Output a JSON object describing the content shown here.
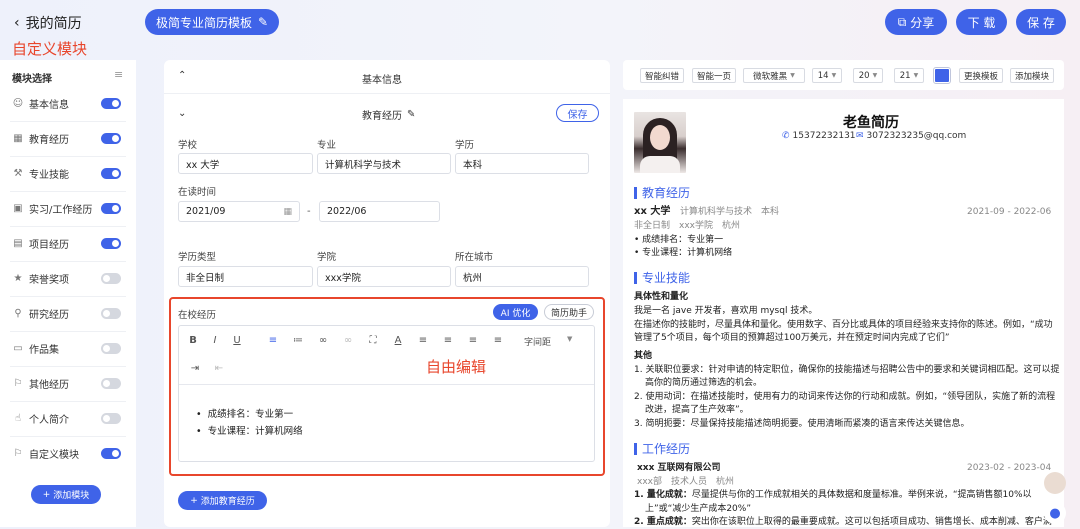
{
  "header": {
    "back_label": "我的简历",
    "custom_module_note": "自定义模块",
    "template_btn": "极简专业简历模板",
    "share": "分享",
    "download": "下 载",
    "save": "保 存"
  },
  "sidebar": {
    "title": "模块选择",
    "items": [
      {
        "label": "基本信息",
        "icon": "user-icon",
        "on": true
      },
      {
        "label": "教育经历",
        "icon": "calendar-icon",
        "on": true
      },
      {
        "label": "专业技能",
        "icon": "wrench-icon",
        "on": true
      },
      {
        "label": "实习/工作经历",
        "icon": "briefcase-icon",
        "on": true
      },
      {
        "label": "项目经历",
        "icon": "document-icon",
        "on": true
      },
      {
        "label": "荣誉奖项",
        "icon": "trophy-icon",
        "on": false
      },
      {
        "label": "研究经历",
        "icon": "search-icon",
        "on": false
      },
      {
        "label": "作品集",
        "icon": "monitor-icon",
        "on": false
      },
      {
        "label": "其他经历",
        "icon": "tag-icon",
        "on": false
      },
      {
        "label": "个人简介",
        "icon": "thumbs-up-icon",
        "on": false
      },
      {
        "label": "自定义模块",
        "icon": "tag-icon",
        "on": true
      }
    ],
    "add_module": "添加模块"
  },
  "editor": {
    "basic_info": "基本信息",
    "education": "教育经历",
    "save": "保存",
    "labels": {
      "school": "学校",
      "major": "专业",
      "degree": "学历",
      "period": "在读时间",
      "edu_type": "学历类型",
      "college": "学院",
      "city": "所在城市",
      "campus": "在校经历"
    },
    "values": {
      "school": "xx 大学",
      "major": "计算机科学与技术",
      "degree": "本科",
      "start": "2021/09",
      "end": "2022/06",
      "edu_type": "非全日制",
      "college": "xxx学院",
      "city": "杭州"
    },
    "ai_optimize": "AI 优化",
    "resume_helper": "简历助手",
    "line_spacing": "字间距",
    "free_edit_note": "自由编辑",
    "bullets": [
      "成绩排名：专业第一",
      "专业课程：计算机网络"
    ],
    "add_education": "添加教育经历"
  },
  "preview_toolbar": {
    "smart_fix": "智能纠错",
    "one_page": "智能一页",
    "font": "微软雅黑",
    "size1": "14",
    "size2": "20",
    "size3": "21",
    "accent": "#3f63e8",
    "change_template": "更换模板",
    "add_module": "添加模块"
  },
  "resume": {
    "name": "老鱼简历",
    "phone": "15372232131",
    "email": "3072323235@qq.com",
    "edu_title": "教育经历",
    "school": "xx 大学",
    "major": "计算机科学与技术",
    "degree": "本科",
    "period": "2021-09 - 2022-06",
    "edu_meta": "非全日制　xxx学院　杭州",
    "edu_bullets": [
      "成绩排名：专业第一",
      "专业课程：计算机网络"
    ],
    "skills_title": "专业技能",
    "skill_h1": "具体性和量化",
    "skill_p1": "我是一名 jave 开发者，喜欢用 mysql 技术。",
    "skill_p2a": "在描述你的技能时，尽量具体和量化。使用数字、百分比或具体的项目经验来支持你的陈述。例如，“成功",
    "skill_p2b": "管理了5个项目，每个项目的预算超过100万美元，并在预定时间内完成了它们”",
    "skill_h2": "其他",
    "skill_o1a": "1. 关联职位要求：针对申请的特定职位，确保你的技能描述与招聘公告中的要求和关键词相匹配。这可以提",
    "skill_o1b": "高你的简历通过筛选的机会。",
    "skill_o2a": "2. 使用动词：在描述技能时，使用有力的动词来传达你的行动和成就。例如，“领导团队，实施了新的流程",
    "skill_o2b": "改进，提高了生产效率”。",
    "skill_o3": "3. 简明扼要：尽量保持技能描述简明扼要。使用清晰而紧凑的语言来传达关键信息。",
    "work_title": "工作经历",
    "company": "xxx 互联网有限公司",
    "work_period": "2023-02 - 2023-04",
    "work_meta": "xxx部　技术人员　杭州",
    "work_w1a": "1. 量化成就：",
    "work_w1b": "尽量提供与你的工作成就相关的具体数据和度量标准。举例来说，“提高销售额10%以",
    "work_w1c": "上”或“减少生产成本20%”",
    "work_w2a": "2. 重点成就：",
    "work_w2b": "突出你在该职位上取得的最重要成就。这可以包括项目成功、销售增长、成本削减、客户满"
  }
}
